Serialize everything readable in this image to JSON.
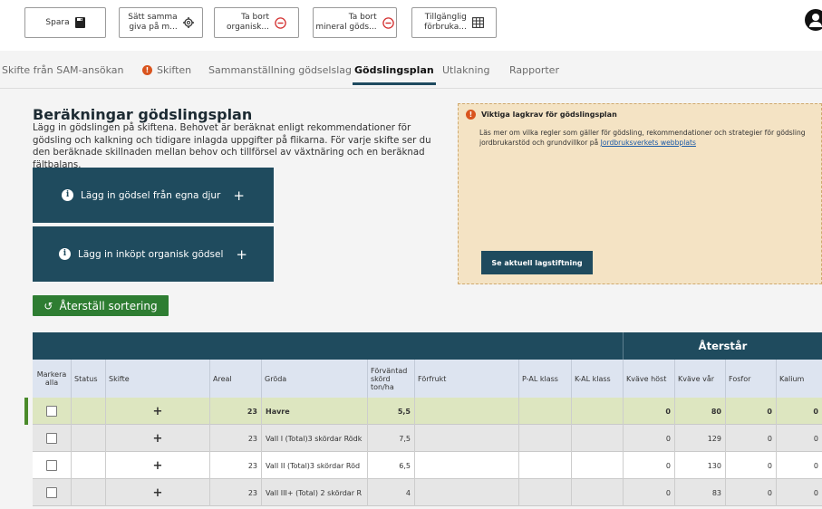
{
  "toolbar": {
    "save": {
      "label": "Spara",
      "icon": "save-icon"
    },
    "same_dose": {
      "line1": "Sätt samma",
      "line2": "giva på m...",
      "icon": "gear-icon"
    },
    "remove_organic": {
      "line1": "Ta bort",
      "line2": "organisk...",
      "icon": "minus-circle-icon"
    },
    "remove_mineral": {
      "line1": "Ta bort",
      "line2": "mineral göds...",
      "icon": "minus-circle-icon"
    },
    "available": {
      "line1": "Tillgänglig",
      "line2": "förbruka...",
      "icon": "table-icon"
    }
  },
  "tabs": [
    {
      "label": "Skifte från SAM-ansökan"
    },
    {
      "label": "Skiften",
      "warning": "!"
    },
    {
      "label": "Sammanställning gödselslag"
    },
    {
      "label": "Gödslingsplan",
      "active": true
    },
    {
      "label": "Utlakning"
    },
    {
      "label": "Rapporter"
    }
  ],
  "heading": "Beräkningar gödslingsplan",
  "description": "Lägg in gödslingen på skiftena. Behovet är beräknat enligt rekommendationer för gödsling och kalkning och tidigare inlagda uppgifter på flikarna. För varje skifte ser du den beräknade skillnaden mellan behov och tillförsel av växtnäring och en beräknad fältbalans.",
  "buttons": {
    "own_manure": "Lägg in gödsel från egna djur",
    "bought_manure": "Lägg in inköpt organisk gödsel",
    "plus": "+",
    "info": "i",
    "reset_sort": "Återställ sortering",
    "reset_icon": "↺"
  },
  "info_box": {
    "warning": "!",
    "title": "Viktiga lagkrav för gödslingsplan",
    "line1": "Läs mer om vilka regler som gäller för gödsling, rekommendationer och strategier för gödsling",
    "line2_prefix": "jordbrukarstöd och grundvillkor på ",
    "link": "Jordbruksverkets webbplats",
    "button": "Se aktuell lagstiftning"
  },
  "table": {
    "group_header": "Återstår",
    "columns": [
      "Markera alla",
      "Status",
      "Skifte",
      "Areal",
      "Gröda",
      "Förväntad skörd ton/ha",
      "Förfrukt",
      "P-AL klass",
      "K-AL klass",
      "Kväve höst",
      "Kväve vår",
      "Fosfor",
      "Kalium"
    ],
    "rows": [
      {
        "skifte": "+",
        "areal": "23",
        "groda": "Havre",
        "skord": "5,5",
        "forfrukt": "",
        "pal": "",
        "kal": "",
        "kvave_host": "0",
        "kvave_var": "80",
        "fosfor": "0",
        "kalium": "0"
      },
      {
        "skifte": "+",
        "areal": "23",
        "groda": "Vall I (Total)3 skördar Rödk",
        "skord": "7,5",
        "forfrukt": "",
        "pal": "",
        "kal": "",
        "kvave_host": "0",
        "kvave_var": "129",
        "fosfor": "0",
        "kalium": "0"
      },
      {
        "skifte": "+",
        "areal": "23",
        "groda": "Vall II (Total)3 skördar Röd",
        "skord": "6,5",
        "forfrukt": "",
        "pal": "",
        "kal": "",
        "kvave_host": "0",
        "kvave_var": "130",
        "fosfor": "0",
        "kalium": "0"
      },
      {
        "skifte": "+",
        "areal": "23",
        "groda": "Vall III+ (Total) 2 skördar R",
        "skord": "4",
        "forfrukt": "",
        "pal": "",
        "kal": "",
        "kvave_host": "0",
        "kvave_var": "83",
        "fosfor": "0",
        "kalium": "0"
      }
    ]
  }
}
